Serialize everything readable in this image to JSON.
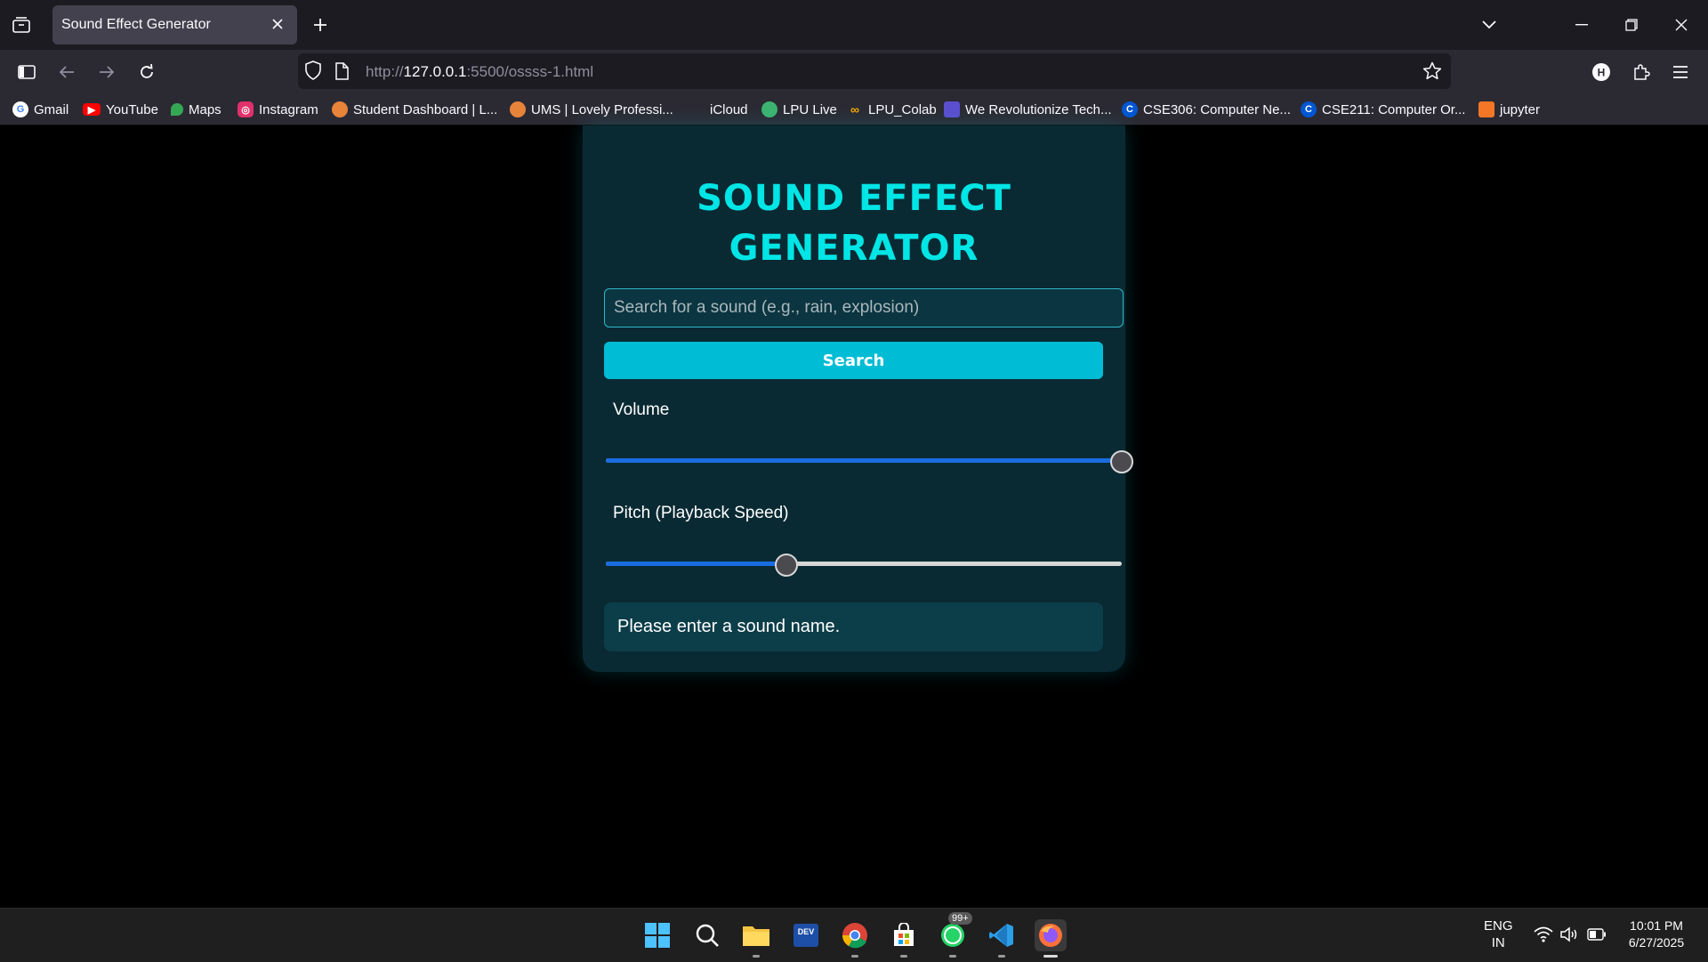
{
  "browser": {
    "tab_title": "Sound Effect Generator",
    "url_prefix": "http://",
    "url_host": "127.0.0.1",
    "url_path": ":5500/ossss-1.html"
  },
  "bookmarks": [
    {
      "label": "Gmail",
      "icon": "google-icon",
      "color": "#4285f4"
    },
    {
      "label": "YouTube",
      "icon": "youtube-icon",
      "color": "#ff0000"
    },
    {
      "label": "Maps",
      "icon": "maps-icon",
      "color": "#34a853"
    },
    {
      "label": "Instagram",
      "icon": "instagram-icon",
      "color": "#e1306c"
    },
    {
      "label": "Student Dashboard | L...",
      "icon": "lpu-icon",
      "color": "#e8833a"
    },
    {
      "label": "UMS | Lovely Professi...",
      "icon": "lpu-icon",
      "color": "#e8833a"
    },
    {
      "label": "iCloud",
      "icon": "apple-icon",
      "color": "#cccccc"
    },
    {
      "label": "LPU Live",
      "icon": "lpu-live-icon",
      "color": "#3cb371"
    },
    {
      "label": "LPU_Colab",
      "icon": "colab-icon",
      "color": "#f9ab00"
    },
    {
      "label": "We Revolutionize Tech...",
      "icon": "bookmark-site-icon",
      "color": "#5a4fcf"
    },
    {
      "label": "CSE306: Computer Ne...",
      "icon": "coursera-icon",
      "color": "#0056d2"
    },
    {
      "label": "CSE211: Computer Or...",
      "icon": "coursera-icon",
      "color": "#0056d2"
    },
    {
      "label": "jupyter",
      "icon": "jupyter-icon",
      "color": "#f37726"
    }
  ],
  "app": {
    "title_line1": "SOUND EFFECT",
    "title_line2": "GENERATOR",
    "search_placeholder": "Search for a sound (e.g., rain, explosion)",
    "search_value": "",
    "search_button": "Search",
    "volume_label": "Volume",
    "volume_value": 1.0,
    "pitch_label": "Pitch (Playback Speed)",
    "pitch_value": 0.35,
    "status_message": "Please enter a sound name."
  },
  "colors": {
    "title": "#00e5e5",
    "button": "#00bcd4",
    "card": "#0a2a33",
    "slider_fill": "#1a6de0"
  },
  "taskbar": {
    "lang": "ENG",
    "region": "IN",
    "time": "10:01 PM",
    "date": "6/27/2025",
    "whatsapp_badge": "99+"
  }
}
